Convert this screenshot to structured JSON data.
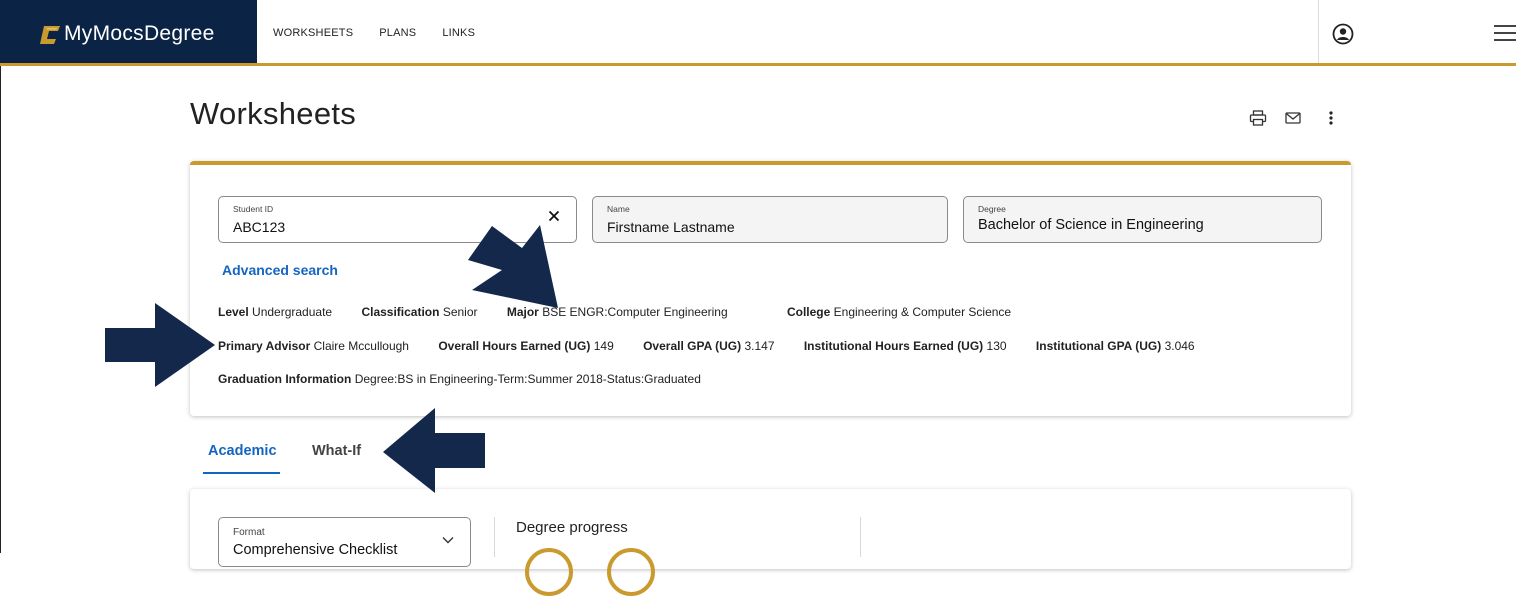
{
  "app": {
    "name": "MyMocsDegree",
    "logo_icon": "c-logo-icon",
    "colors": {
      "navy": "#0b2446",
      "gold": "#c99a2e",
      "link_blue": "#1565c0",
      "arrow": "#13284a"
    }
  },
  "nav": {
    "links": [
      "WORKSHEETS",
      "PLANS",
      "LINKS"
    ],
    "user_icon": "account-circle-icon",
    "menu_icon": "hamburger-menu-icon"
  },
  "page": {
    "title": "Worksheets",
    "tools": [
      "print-icon",
      "email-icon",
      "more-vertical-icon"
    ]
  },
  "student": {
    "student_id": {
      "label": "Student ID",
      "value": "ABC123"
    },
    "name": {
      "label": "Name",
      "value": "Firstname Lastname"
    },
    "degree": {
      "label": "Degree",
      "value": "Bachelor of Science in Engineering"
    },
    "advanced_search": "Advanced search",
    "level": {
      "label": "Level",
      "value": "Undergraduate"
    },
    "classification": {
      "label": "Classification",
      "value": "Senior"
    },
    "major": {
      "label": "Major",
      "value": "BSE ENGR:Computer Engineering"
    },
    "college": {
      "label": "College",
      "value": "Engineering & Computer Science"
    },
    "primary_advisor": {
      "label": "Primary Advisor",
      "value": "Claire Mccullough"
    },
    "overall_hours": {
      "label": "Overall Hours Earned (UG)",
      "value": "149"
    },
    "overall_gpa": {
      "label": "Overall GPA (UG)",
      "value": "3.147"
    },
    "inst_hours": {
      "label": "Institutional Hours Earned (UG)",
      "value": "130"
    },
    "inst_gpa": {
      "label": "Institutional GPA (UG)",
      "value": "3.046"
    },
    "graduation": {
      "label": "Graduation Information",
      "value": "Degree:BS in Engineering-Term:Summer 2018-Status:Graduated"
    }
  },
  "tabs": [
    {
      "label": "Academic",
      "active": true
    },
    {
      "label": "What-If",
      "active": false
    }
  ],
  "worksheet": {
    "format": {
      "label": "Format",
      "value": "Comprehensive Checklist"
    },
    "progress_title": "Degree progress"
  }
}
